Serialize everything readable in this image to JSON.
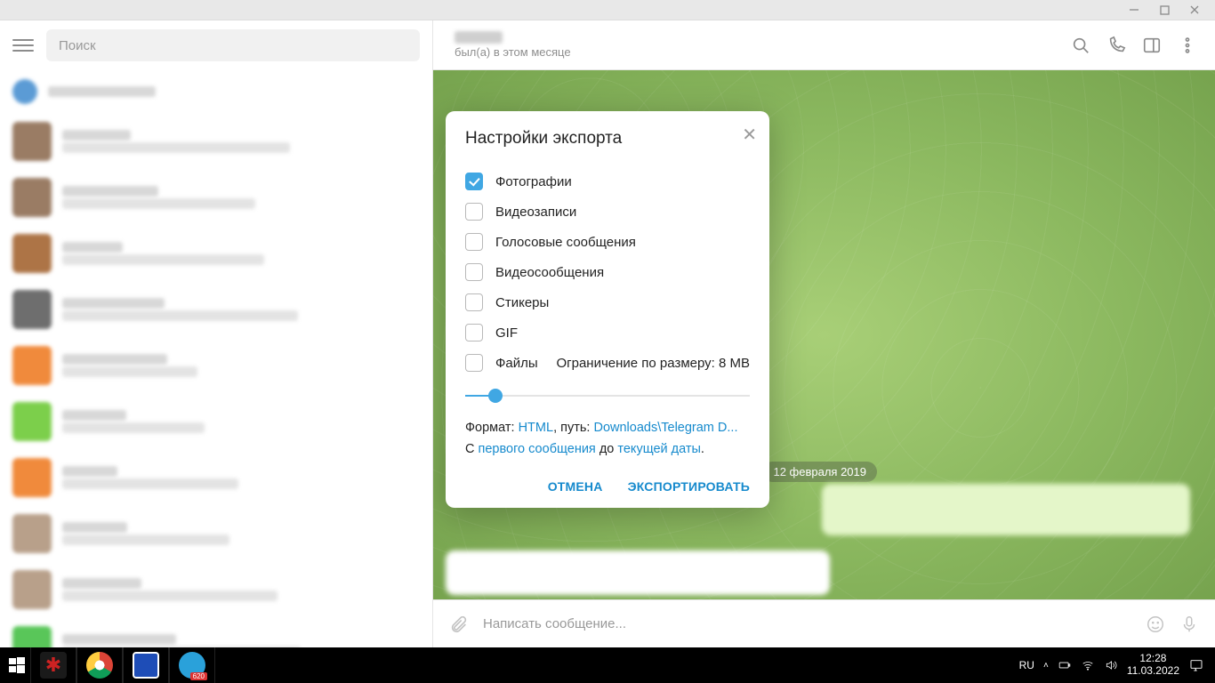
{
  "titlebar": {},
  "sidebar": {
    "search_placeholder": "Поиск",
    "chat_colors": [
      "#5b9bd5",
      "#9a7c64",
      "#9a7c64",
      "#ad7446",
      "#6e6e6e",
      "#f08a3c",
      "#7ccf4b",
      "#f08a3c",
      "#b8a08a",
      "#b8a08a",
      "#59c659"
    ]
  },
  "chat": {
    "status": "был(а) в этом месяце",
    "date_badge": "12 февраля 2019",
    "input_placeholder": "Написать сообщение..."
  },
  "modal": {
    "title": "Настройки экспорта",
    "options": [
      {
        "label": "Фотографии",
        "checked": true
      },
      {
        "label": "Видеозаписи",
        "checked": false
      },
      {
        "label": "Голосовые сообщения",
        "checked": false
      },
      {
        "label": "Видеосообщения",
        "checked": false
      },
      {
        "label": "Стикеры",
        "checked": false
      },
      {
        "label": "GIF",
        "checked": false
      }
    ],
    "files_label": "Файлы",
    "size_limit": "Ограничение по размеру: 8 MB",
    "format_prefix": "Формат: ",
    "format_value": "HTML",
    "path_prefix": ", путь: ",
    "path_value": "Downloads\\Telegram D...",
    "range_prefix": "С ",
    "range_from": "первого сообщения",
    "range_mid": " до ",
    "range_to": "текущей даты",
    "range_suffix": ".",
    "cancel": "ОТМЕНА",
    "export": "ЭКСПОРТИРОВАТЬ"
  },
  "taskbar": {
    "lang": "RU",
    "time": "12:28",
    "date": "11.03.2022"
  }
}
